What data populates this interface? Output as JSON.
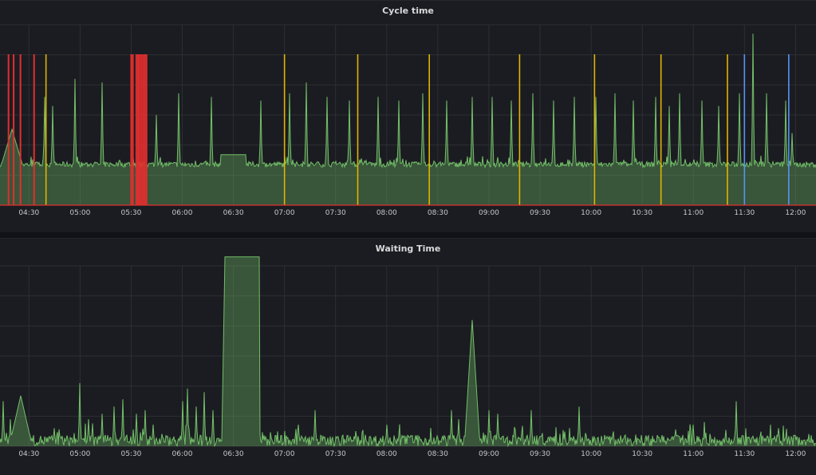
{
  "colors": {
    "background": "#1b1c21",
    "grid": "#2d2e33",
    "series_green": "#73bf69",
    "series_fill": "rgba(115,191,105,0.35)",
    "annotation_red": "#e02f2f",
    "annotation_yellow": "#e0b400",
    "annotation_blue": "#5794f2"
  },
  "panels": {
    "cycle": {
      "title": "Cycle time"
    },
    "wait": {
      "title": "Waiting Time"
    }
  },
  "chart_data": [
    {
      "type": "area",
      "title": "Cycle time",
      "xlabel": "",
      "ylabel": "",
      "xlim": [
        "04:13",
        "12:12"
      ],
      "x_ticks": [
        "04:30",
        "05:00",
        "05:30",
        "06:00",
        "06:30",
        "07:00",
        "07:30",
        "08:00",
        "08:30",
        "09:00",
        "09:30",
        "10:00",
        "10:30",
        "11:00",
        "11:30",
        "12:00"
      ],
      "y_ticks": [],
      "grid": true,
      "legend": "none",
      "series": [
        {
          "baseline": 0.22,
          "noise": 0.015,
          "peaks": [
            {
              "x": "04:20",
              "y": 0.42,
              "w": 12
            },
            {
              "x": "04:39",
              "y": 0.6,
              "w": 1
            },
            {
              "x": "04:44",
              "y": 0.55,
              "w": 1
            },
            {
              "x": "04:57",
              "y": 0.7,
              "w": 1
            },
            {
              "x": "05:13",
              "y": 0.68,
              "w": 1
            },
            {
              "x": "05:45",
              "y": 0.5,
              "w": 1
            },
            {
              "x": "05:58",
              "y": 0.62,
              "w": 1
            },
            {
              "x": "06:17",
              "y": 0.6,
              "w": 1
            },
            {
              "x": "06:46",
              "y": 0.58,
              "w": 1
            },
            {
              "x": "07:03",
              "y": 0.62,
              "w": 1
            },
            {
              "x": "07:13",
              "y": 0.68,
              "w": 1
            },
            {
              "x": "07:25",
              "y": 0.6,
              "w": 1
            },
            {
              "x": "07:38",
              "y": 0.58,
              "w": 1
            },
            {
              "x": "07:55",
              "y": 0.6,
              "w": 1
            },
            {
              "x": "08:07",
              "y": 0.58,
              "w": 1
            },
            {
              "x": "08:21",
              "y": 0.62,
              "w": 1
            },
            {
              "x": "08:35",
              "y": 0.58,
              "w": 1
            },
            {
              "x": "08:50",
              "y": 0.6,
              "w": 1
            },
            {
              "x": "09:02",
              "y": 0.6,
              "w": 1
            },
            {
              "x": "09:13",
              "y": 0.58,
              "w": 1
            },
            {
              "x": "09:26",
              "y": 0.62,
              "w": 1
            },
            {
              "x": "09:38",
              "y": 0.58,
              "w": 1
            },
            {
              "x": "09:50",
              "y": 0.6,
              "w": 1
            },
            {
              "x": "10:03",
              "y": 0.6,
              "w": 1
            },
            {
              "x": "10:14",
              "y": 0.62,
              "w": 1
            },
            {
              "x": "10:25",
              "y": 0.58,
              "w": 1
            },
            {
              "x": "10:38",
              "y": 0.6,
              "w": 1
            },
            {
              "x": "10:46",
              "y": 0.55,
              "w": 1
            },
            {
              "x": "10:52",
              "y": 0.62,
              "w": 1
            },
            {
              "x": "11:05",
              "y": 0.58,
              "w": 1
            },
            {
              "x": "11:15",
              "y": 0.55,
              "w": 1
            },
            {
              "x": "11:27",
              "y": 0.62,
              "w": 1
            },
            {
              "x": "11:35",
              "y": 0.95,
              "w": 1
            },
            {
              "x": "11:43",
              "y": 0.62,
              "w": 1
            },
            {
              "x": "11:54",
              "y": 0.58,
              "w": 1
            },
            {
              "x": "11:58",
              "y": 0.4,
              "w": 1
            }
          ],
          "plateaus": [
            {
              "from": "06:22",
              "to": "06:37",
              "y": 0.28
            }
          ]
        }
      ],
      "annotations": [
        {
          "x": "04:18",
          "color": "red"
        },
        {
          "x": "04:21",
          "color": "red"
        },
        {
          "x": "04:25",
          "color": "red"
        },
        {
          "x": "04:33",
          "color": "red"
        },
        {
          "x": "04:40",
          "color": "yellow"
        },
        {
          "x": "05:30",
          "color": "red"
        },
        {
          "x": "05:31",
          "color": "red"
        },
        {
          "x": "05:33",
          "color": "red"
        },
        {
          "x": "05:34",
          "color": "red"
        },
        {
          "x": "05:35",
          "color": "red"
        },
        {
          "x": "05:36",
          "color": "red"
        },
        {
          "x": "05:37",
          "color": "red"
        },
        {
          "x": "05:38",
          "color": "red"
        },
        {
          "x": "05:39",
          "color": "red"
        },
        {
          "x": "07:00",
          "color": "yellow"
        },
        {
          "x": "07:43",
          "color": "yellow"
        },
        {
          "x": "08:25",
          "color": "yellow"
        },
        {
          "x": "09:18",
          "color": "yellow"
        },
        {
          "x": "10:02",
          "color": "yellow"
        },
        {
          "x": "10:41",
          "color": "yellow"
        },
        {
          "x": "11:20",
          "color": "yellow"
        },
        {
          "x": "11:30",
          "color": "blue"
        },
        {
          "x": "11:56",
          "color": "blue"
        }
      ]
    },
    {
      "type": "area",
      "title": "Waiting Time",
      "xlabel": "",
      "ylabel": "",
      "xlim": [
        "04:13",
        "12:12"
      ],
      "x_ticks": [
        "04:30",
        "05:00",
        "05:30",
        "06:00",
        "06:30",
        "07:00",
        "07:30",
        "08:00",
        "08:30",
        "09:00",
        "09:30",
        "10:00",
        "10:30",
        "11:00",
        "11:30",
        "12:00"
      ],
      "y_ticks": [],
      "grid": true,
      "legend": "none",
      "series": [
        {
          "baseline": 0.02,
          "noise": 0.03,
          "peaks": [
            {
              "x": "04:15",
              "y": 0.25,
              "w": 1
            },
            {
              "x": "04:19",
              "y": 0.15,
              "w": 1
            },
            {
              "x": "04:25",
              "y": 0.28,
              "w": 12
            },
            {
              "x": "04:45",
              "y": 0.1,
              "w": 1
            },
            {
              "x": "05:00",
              "y": 0.35,
              "w": 1
            },
            {
              "x": "05:05",
              "y": 0.15,
              "w": 1
            },
            {
              "x": "05:13",
              "y": 0.18,
              "w": 1
            },
            {
              "x": "05:20",
              "y": 0.22,
              "w": 1
            },
            {
              "x": "05:25",
              "y": 0.26,
              "w": 1
            },
            {
              "x": "05:33",
              "y": 0.18,
              "w": 1
            },
            {
              "x": "05:38",
              "y": 0.2,
              "w": 1
            },
            {
              "x": "05:43",
              "y": 0.12,
              "w": 1
            },
            {
              "x": "06:00",
              "y": 0.25,
              "w": 1
            },
            {
              "x": "06:03",
              "y": 0.32,
              "w": 1
            },
            {
              "x": "06:08",
              "y": 0.22,
              "w": 1
            },
            {
              "x": "06:13",
              "y": 0.3,
              "w": 1
            },
            {
              "x": "06:18",
              "y": 0.2,
              "w": 1
            },
            {
              "x": "07:08",
              "y": 0.12,
              "w": 1
            },
            {
              "x": "07:18",
              "y": 0.2,
              "w": 1
            },
            {
              "x": "08:00",
              "y": 0.12,
              "w": 1
            },
            {
              "x": "08:38",
              "y": 0.2,
              "w": 1
            },
            {
              "x": "08:42",
              "y": 0.15,
              "w": 1
            },
            {
              "x": "08:50",
              "y": 0.7,
              "w": 8
            },
            {
              "x": "09:00",
              "y": 0.2,
              "w": 1
            },
            {
              "x": "09:05",
              "y": 0.18,
              "w": 1
            },
            {
              "x": "09:25",
              "y": 0.2,
              "w": 1
            },
            {
              "x": "09:53",
              "y": 0.22,
              "w": 1
            },
            {
              "x": "11:00",
              "y": 0.12,
              "w": 1
            },
            {
              "x": "11:25",
              "y": 0.25,
              "w": 1
            },
            {
              "x": "12:00",
              "y": 0.06,
              "w": 1
            }
          ],
          "plateaus": [
            {
              "from": "06:23",
              "to": "06:45",
              "y": 1.05,
              "ramp": 4
            }
          ]
        }
      ],
      "annotations": []
    }
  ]
}
